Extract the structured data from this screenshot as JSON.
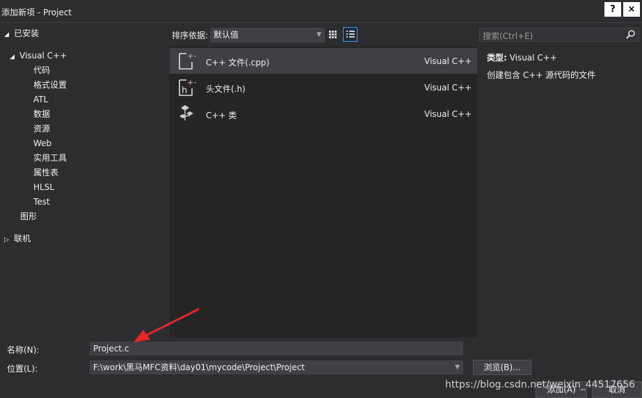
{
  "window": {
    "title": "添加新项 - Project",
    "help_label": "?",
    "close_label": "×"
  },
  "tree": {
    "installed": "已安装",
    "visual_cpp": "Visual C++",
    "children": [
      "代码",
      "格式设置",
      "ATL",
      "数据",
      "资源",
      "Web",
      "实用工具",
      "属性表",
      "HLSL",
      "Test"
    ],
    "graphics": "图形",
    "online": "联机"
  },
  "toolbar": {
    "sort_label": "排序依据:",
    "sort_value": "默认值"
  },
  "templates": [
    {
      "name": "C++ 文件(.cpp)",
      "lang": "Visual C++"
    },
    {
      "name": "头文件(.h)",
      "lang": "Visual C++"
    },
    {
      "name": "C++ 类",
      "lang": "Visual C++"
    }
  ],
  "search": {
    "placeholder": "搜索(Ctrl+E)"
  },
  "details": {
    "type_label": "类型:",
    "type_value": "Visual C++",
    "description": "创建包含 C++ 源代码的文件"
  },
  "form": {
    "name_label": "名称(N):",
    "name_value": "Project.c",
    "location_label": "位置(L):",
    "location_value": "F:\\work\\黑马MFC资料\\day01\\mycode\\Project\\Project",
    "browse_label": "浏览(B)...",
    "add_label": "添加(A)",
    "cancel_label": "取消"
  },
  "watermark": "https://blog.csdn.net/weixin_44517656",
  "colors": {
    "accent": "#3399ff",
    "annotation": "#e8262a",
    "icon_accent": "#c586c0"
  }
}
